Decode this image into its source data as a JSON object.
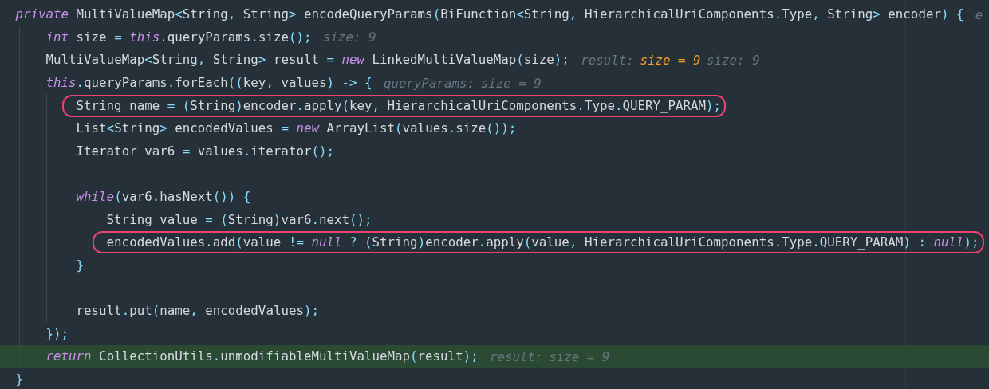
{
  "editor": {
    "lines": [
      {
        "kind": "code",
        "boxed": false,
        "current": false,
        "tokens": [
          {
            "kind": "keyword",
            "text": "private"
          },
          {
            "kind": "plain",
            "text": " MultiValueMap<String, String> encodeQueryParams(BiFunction<String, HierarchicalUriComponents.Type, String> encoder) {"
          }
        ],
        "hints": [
          {
            "kind": "muted",
            "text": "e"
          }
        ],
        "children": [
          {
            "kind": "code",
            "boxed": false,
            "current": false,
            "tokens": [
              {
                "kind": "keyword",
                "text": "int"
              },
              {
                "kind": "plain",
                "text": " size = "
              },
              {
                "kind": "keyword",
                "text": "this"
              },
              {
                "kind": "plain",
                "text": ".queryParams.size();"
              }
            ],
            "hints": [
              {
                "kind": "muted",
                "text": "size: 9"
              }
            ]
          },
          {
            "kind": "code",
            "boxed": false,
            "current": false,
            "tokens": [
              {
                "kind": "plain",
                "text": "MultiValueMap<String, String> result = "
              },
              {
                "kind": "keyword",
                "text": "new"
              },
              {
                "kind": "plain",
                "text": " LinkedMultiValueMap(size);"
              }
            ],
            "hints": [
              {
                "kind": "muted",
                "text": "result:"
              },
              {
                "kind": "value",
                "text": "size = 9"
              },
              {
                "kind": "muted",
                "text": "size: 9"
              }
            ]
          },
          {
            "kind": "code",
            "boxed": false,
            "current": false,
            "tokens": [
              {
                "kind": "keyword",
                "text": "this"
              },
              {
                "kind": "plain",
                "text": ".queryParams.forEach((key, values) -> {"
              }
            ],
            "hints": [
              {
                "kind": "muted",
                "text": "queryParams:"
              },
              {
                "kind": "muted",
                "text": "size = 9"
              }
            ],
            "children": [
              {
                "kind": "code",
                "boxed": true,
                "current": false,
                "tokens": [
                  {
                    "kind": "plain",
                    "text": "String name = (String)encoder.apply(key, HierarchicalUriComponents.Type.QUERY_PARAM);"
                  }
                ]
              },
              {
                "kind": "code",
                "boxed": false,
                "current": false,
                "tokens": [
                  {
                    "kind": "plain",
                    "text": "List<String> encodedValues = "
                  },
                  {
                    "kind": "keyword",
                    "text": "new"
                  },
                  {
                    "kind": "plain",
                    "text": " ArrayList(values.size());"
                  }
                ]
              },
              {
                "kind": "code",
                "boxed": false,
                "current": false,
                "tokens": [
                  {
                    "kind": "plain",
                    "text": "Iterator var6 = values.iterator();"
                  }
                ]
              },
              {
                "kind": "blank"
              },
              {
                "kind": "code",
                "boxed": false,
                "current": false,
                "tokens": [
                  {
                    "kind": "keyword",
                    "text": "while"
                  },
                  {
                    "kind": "plain",
                    "text": "(var6.hasNext()) {"
                  }
                ],
                "children": [
                  {
                    "kind": "code",
                    "boxed": false,
                    "current": false,
                    "tokens": [
                      {
                        "kind": "plain",
                        "text": "String value = (String)var6.next();"
                      }
                    ]
                  },
                  {
                    "kind": "code",
                    "boxed": true,
                    "current": false,
                    "tokens": [
                      {
                        "kind": "plain",
                        "text": "encodedValues.add(value != "
                      },
                      {
                        "kind": "keyword",
                        "text": "null"
                      },
                      {
                        "kind": "plain",
                        "text": " ? (String)encoder.apply(value, HierarchicalUriComponents.Type.QUERY_PARAM) : "
                      },
                      {
                        "kind": "keyword",
                        "text": "null"
                      },
                      {
                        "kind": "plain",
                        "text": ");"
                      }
                    ]
                  }
                ]
              },
              {
                "kind": "code",
                "boxed": false,
                "current": false,
                "tokens": [
                  {
                    "kind": "plain",
                    "text": "}"
                  }
                ]
              },
              {
                "kind": "blank"
              },
              {
                "kind": "code",
                "boxed": false,
                "current": false,
                "tokens": [
                  {
                    "kind": "plain",
                    "text": "result.put(name, encodedValues);"
                  }
                ]
              }
            ]
          },
          {
            "kind": "code",
            "boxed": false,
            "current": false,
            "tokens": [
              {
                "kind": "plain",
                "text": "});"
              }
            ]
          },
          {
            "kind": "code",
            "boxed": false,
            "current": true,
            "tokens": [
              {
                "kind": "keyword",
                "text": "return"
              },
              {
                "kind": "plain",
                "text": " CollectionUtils.unmodifiableMultiValueMap(result);"
              }
            ],
            "hints": [
              {
                "kind": "muted",
                "text": "result:"
              },
              {
                "kind": "muted",
                "text": "size = 9"
              }
            ]
          }
        ]
      },
      {
        "kind": "code",
        "boxed": false,
        "current": false,
        "tokens": [
          {
            "kind": "plain",
            "text": "}"
          }
        ]
      }
    ]
  }
}
